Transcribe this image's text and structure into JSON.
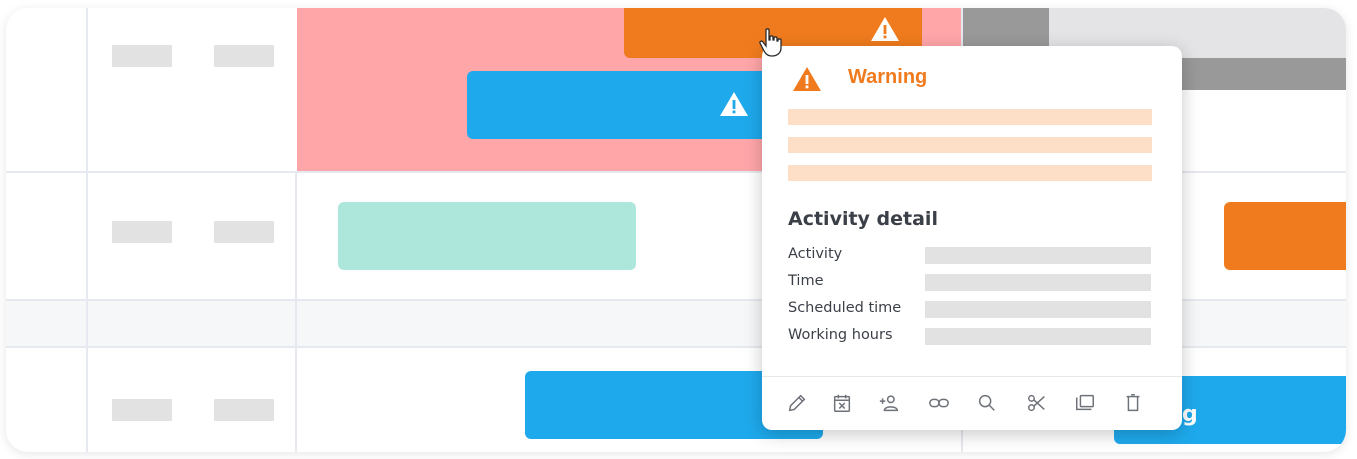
{
  "colors": {
    "warning_orange": "#f07b1e",
    "blue": "#1ea9ec",
    "pink": "#ffa6a9",
    "mint": "#ade6da",
    "gray": "#999999",
    "light_gray": "#e2e2e2"
  },
  "timeline": {
    "bar_label_partial": "g"
  },
  "popover": {
    "title": "Warning",
    "title_icon": "warning-triangle-icon",
    "section_title": "Activity detail",
    "rows": [
      {
        "label": "Activity"
      },
      {
        "label": "Time"
      },
      {
        "label": "Scheduled time"
      },
      {
        "label": "Working hours"
      }
    ],
    "toolbar": [
      {
        "icon": "pencil-icon"
      },
      {
        "icon": "calendar-remove-icon"
      },
      {
        "icon": "add-person-icon"
      },
      {
        "icon": "link-icon"
      },
      {
        "icon": "search-icon"
      },
      {
        "icon": "scissors-icon"
      },
      {
        "icon": "folder-icon"
      },
      {
        "icon": "trash-icon"
      }
    ]
  }
}
